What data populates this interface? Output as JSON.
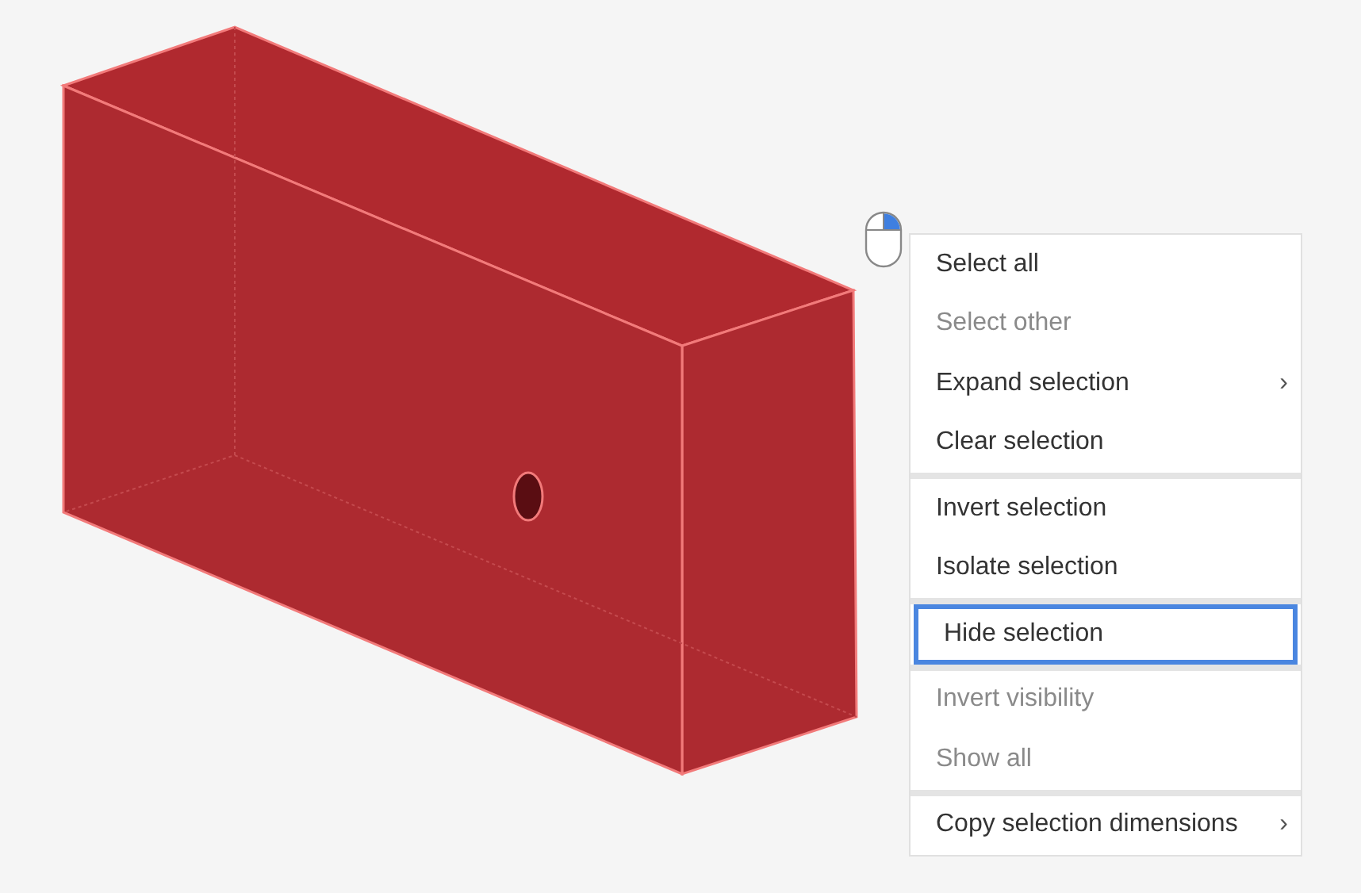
{
  "context_menu": {
    "groups": [
      {
        "items": [
          {
            "label": "Select all",
            "disabled": false,
            "selected": false
          },
          {
            "label": "Select other",
            "disabled": true,
            "selected": false
          },
          {
            "label": "Expand selection",
            "disabled": false,
            "selected": false,
            "arrow": "›"
          },
          {
            "label": "Clear selection",
            "disabled": false,
            "selected": false
          }
        ]
      },
      {
        "items": [
          {
            "label": "Invert selection",
            "disabled": false,
            "selected": false
          },
          {
            "label": "Isolate selection",
            "disabled": false,
            "selected": false
          }
        ]
      },
      {
        "items": [
          {
            "label": "Hide selection",
            "disabled": false,
            "selected": true
          }
        ]
      },
      {
        "items": [
          {
            "label": "Invert visibility",
            "disabled": true,
            "selected": false
          },
          {
            "label": "Show all",
            "disabled": true,
            "selected": false
          }
        ]
      },
      {
        "items": [
          {
            "label": "Copy selection dimensions",
            "disabled": false,
            "selected": false,
            "arrow": "›"
          }
        ]
      }
    ]
  }
}
